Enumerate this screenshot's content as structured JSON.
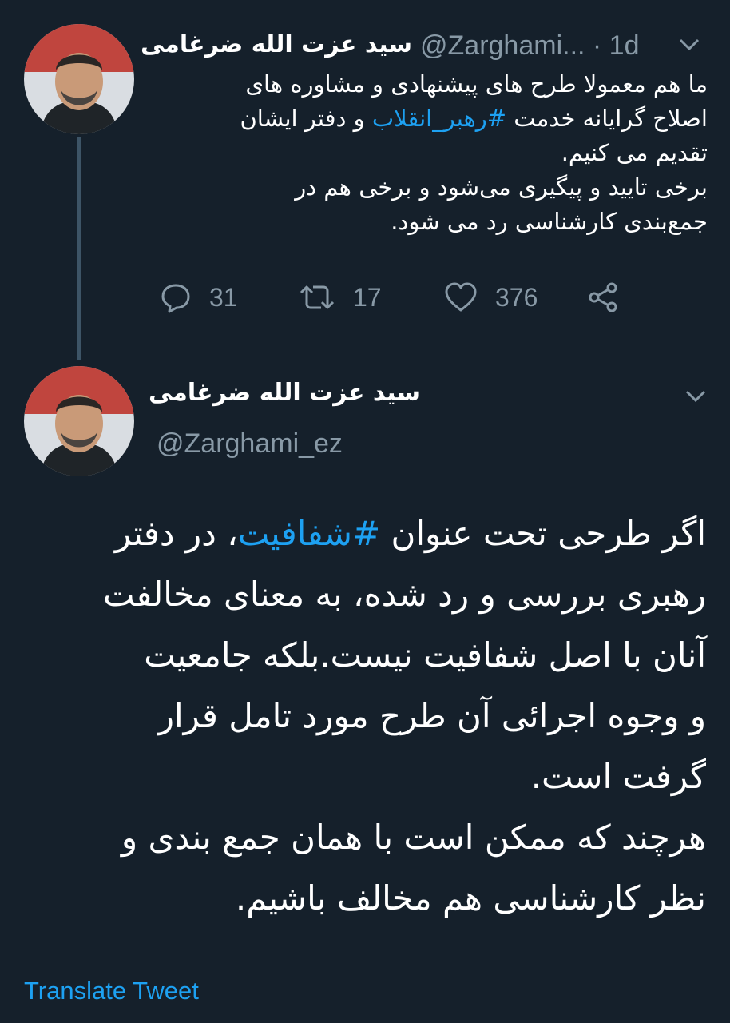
{
  "colors": {
    "background": "#15202b",
    "text": "#ffffff",
    "muted": "#8899a6",
    "link": "#1da1f2",
    "thread_line": "#3d5466"
  },
  "tweet1": {
    "author_name": "سید عزت الله ضرغامی",
    "handle_time": "@Zarghami... · 1d",
    "text": {
      "line1": "ما هم معمولا طرح های پیشنهادی و مشاوره های",
      "line2_before": "اصلاح گرایانه خدمت ",
      "hashtag": "#رهبر_انقلاب",
      "line2_after": " و دفتر ایشان",
      "line3": "تقدیم می کنیم.",
      "line4": "برخی تایید و پیگیری می‌شود و برخی هم در",
      "line5": "جمع‌بندی کارشناسی رد می شود."
    },
    "stats": {
      "replies": "31",
      "retweets": "17",
      "likes": "376"
    },
    "icons": [
      "reply-icon",
      "retweet-icon",
      "like-icon",
      "share-icon",
      "chevron-down-icon"
    ]
  },
  "tweet2": {
    "author_name": "سید عزت الله ضرغامی",
    "handle": "@Zarghami_ez",
    "text": {
      "line1_before": "اگر طرحی تحت عنوان ",
      "hashtag": "#شفافیت",
      "line1_after": "، در دفتر",
      "line2": "رهبری بررسی و رد شده، به معنای مخالفت",
      "line3": "آنان با اصل شفافیت نیست.بلکه جامعیت",
      "line4": "و وجوه اجرائی آن طرح مورد تامل قرار",
      "line5": "گرفت است.",
      "line6": "هرچند که ممکن است با همان جمع بندی و",
      "line7": "نظر کارشناسی هم مخالف باشیم."
    },
    "translate_label": "Translate Tweet"
  }
}
